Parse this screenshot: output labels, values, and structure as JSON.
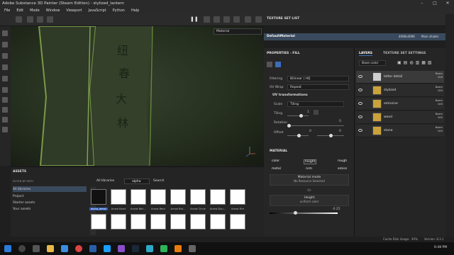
{
  "window": {
    "title": "Adobe Substance 3D Painter (Steam Edition) - stylized_lantern"
  },
  "menu": [
    "File",
    "Edit",
    "Mode",
    "Window",
    "Viewport",
    "JavaScript",
    "Python",
    "Help"
  ],
  "viewport": {
    "material_select": "Material"
  },
  "texture_set_list": {
    "title": "TEXTURE SET LIST",
    "item": "DefaultMaterial",
    "size": "4096x4096",
    "shader": "Main shader"
  },
  "properties": {
    "title": "PROPERTIES - FILL",
    "filtering_label": "Filtering",
    "filtering_value": "Bilinear | HQ",
    "uvwrap_label": "UV Wrap",
    "uvwrap_value": "Repeat",
    "uv_title": "UV transformations",
    "scale_label": "Scale",
    "scale_value": "Tiling",
    "tiling_label": "Tiling",
    "tiling_value": "1",
    "rotation_label": "Rotation",
    "rotation_value": "0",
    "offset_label": "Offset",
    "offset_value1": "0",
    "offset_value2": "0",
    "material_title": "MATERIAL",
    "channels": [
      "color",
      "height",
      "rough",
      "metal",
      "nrm",
      "emiss"
    ],
    "material_mode_label": "Material mode",
    "material_mode_value": "No Resource Selected",
    "or_label": "Or",
    "height_label": "Height",
    "height_sub": "uniform color",
    "height_value": "-0.25"
  },
  "layers": {
    "tab1": "LAYERS",
    "tab2": "TEXTURE SET SETTINGS",
    "channel": "Base color",
    "items": [
      {
        "name": "letter detail",
        "mode": "Norm",
        "value": "100"
      },
      {
        "name": "stylized",
        "mode": "Norm",
        "value": "100"
      },
      {
        "name": "emissive",
        "mode": "Norm",
        "value": "100"
      },
      {
        "name": "wood",
        "mode": "Norm",
        "value": "100"
      },
      {
        "name": "stone",
        "mode": "Norm",
        "value": "100"
      }
    ]
  },
  "assets": {
    "title": "ASSETS",
    "filter_label": "FILTER BY PATH",
    "all_libraries": "All libraries",
    "search_value": "alpha",
    "search_label": "Search",
    "libs": [
      "All libraries",
      "Project",
      "Starter assets",
      "Your assets"
    ],
    "thumbs": [
      "alpha_detail",
      "Arrow Band",
      "Arrow Ben...",
      "Arrow Bent",
      "Arrow Bro...",
      "Arrow Circle",
      "Arrow Dou...",
      "Arrow Fire"
    ]
  },
  "status": {
    "cache": "Cache Disk Usage:",
    "cache_value": "93%",
    "version": "Version: 8.3.1"
  },
  "taskbar": {
    "time": "6:48 PM"
  }
}
